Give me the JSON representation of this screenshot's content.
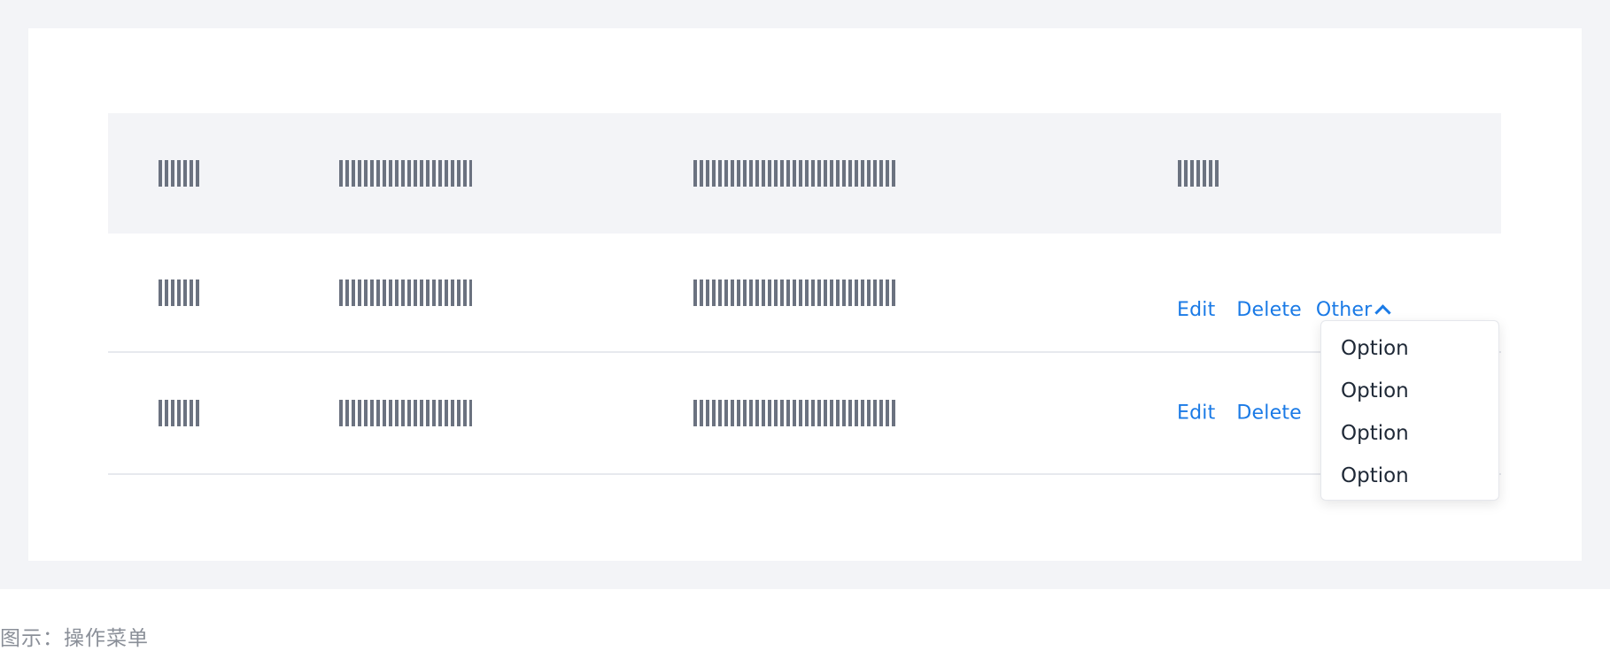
{
  "table": {
    "header": [
      "placeholder",
      "placeholder",
      "placeholder",
      "placeholder"
    ],
    "rows": [
      {
        "actions": {
          "edit": "Edit",
          "delete": "Delete",
          "other": "Other"
        }
      },
      {
        "actions": {
          "edit": "Edit",
          "delete": "Delete"
        }
      }
    ]
  },
  "dropdown": {
    "items": [
      "Option",
      "Option",
      "Option",
      "Option"
    ]
  },
  "caption": "图示：操作菜单",
  "colors": {
    "link": "#1a7ae6",
    "header_bg": "#f3f4f7",
    "placeholder": "#6b7280"
  }
}
